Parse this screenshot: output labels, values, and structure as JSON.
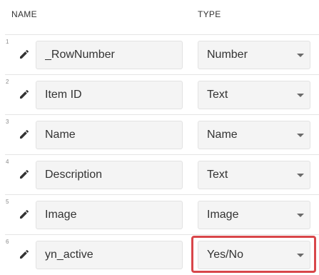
{
  "header": {
    "name_label": "NAME",
    "type_label": "TYPE"
  },
  "rows": [
    {
      "number": "1",
      "name": "_RowNumber",
      "type": "Number"
    },
    {
      "number": "2",
      "name": "Item ID",
      "type": "Text"
    },
    {
      "number": "3",
      "name": "Name",
      "type": "Name"
    },
    {
      "number": "4",
      "name": "Description",
      "type": "Text"
    },
    {
      "number": "5",
      "name": "Image",
      "type": "Image"
    },
    {
      "number": "6",
      "name": "yn_active",
      "type": "Yes/No"
    }
  ],
  "colors": {
    "highlight": "#d8464a",
    "field_background": "#f4f4f4"
  },
  "icons": {
    "edit": "pencil-icon",
    "dropdown": "caret-down-icon"
  }
}
